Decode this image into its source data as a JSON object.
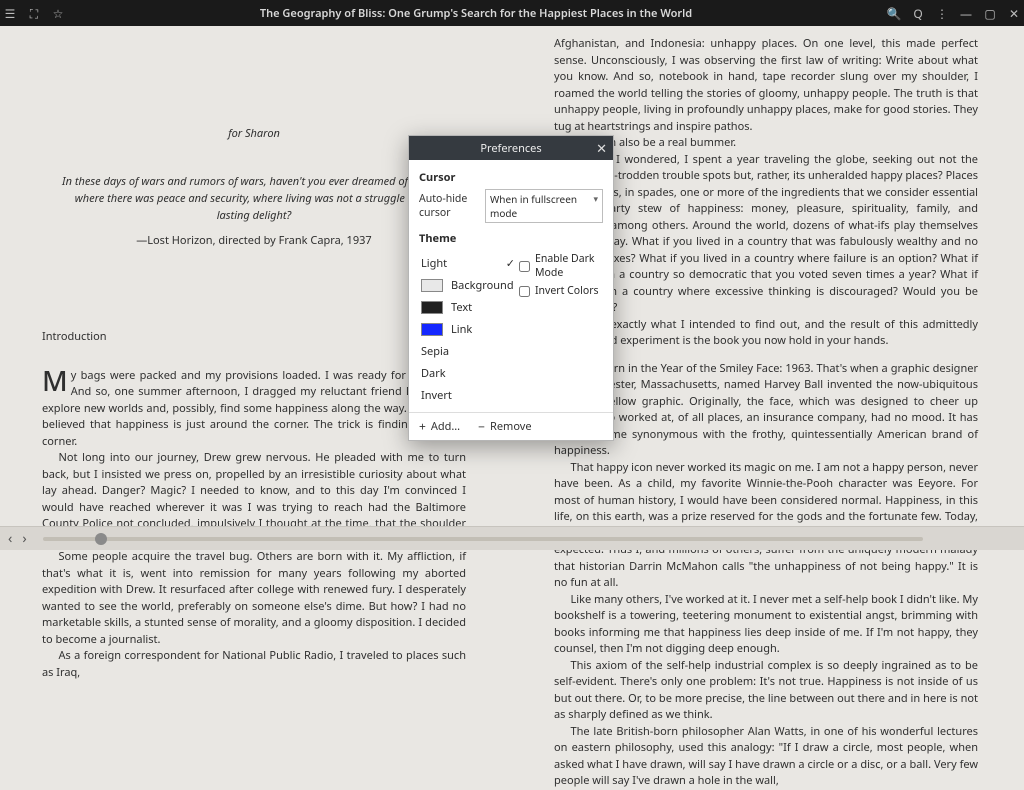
{
  "titlebar": {
    "title": "The Geography of Bliss: One Grump's Search for the Happiest Places in the World",
    "icons": {
      "toc": "☰",
      "fullscreen": "⛶",
      "star": "☆",
      "search": "🔍",
      "zoom": "Q",
      "menu": "⋮",
      "minimize": "—",
      "maximize": "▢",
      "close": "✕"
    }
  },
  "left_page": {
    "dedication": "for Sharon",
    "epigraph": "In these days of wars and rumors of wars, haven't you ever dreamed of a place where there was peace and security, where living was not a struggle but a lasting delight?",
    "epigraph_source": "—Lost Horizon, directed by Frank Capra, 1937",
    "chapter_label": "Introduction",
    "dropcap": "M",
    "p1_rest": "y bags were packed and my provisions loaded. I was ready for adventure. And so, one summer afternoon, I dragged my reluctant friend Drew off to explore new worlds and, possibly, find some happiness along the way. I've always believed that happiness is just around the corner. The trick is finding the right corner.",
    "p2": "Not long into our journey, Drew grew nervous. He pleaded with me to turn back, but I insisted we press on, propelled by an irresistible curiosity about what lay ahead. Danger? Magic? I needed to know, and to this day I'm convinced I would have reached wherever it was I was trying to reach had the Baltimore County Police not concluded, impulsively I thought at the time, that the shoulder of a major thoroughfare was no place for a couple of five-year-olds.",
    "p3": "Some people acquire the travel bug. Others are born with it. My affliction, if that's what it is, went into remission for many years following my aborted expedition with Drew. It resurfaced after college with renewed fury. I desperately wanted to see the world, preferably on someone else's dime. But how? I had no marketable skills, a stunted sense of morality, and a gloomy disposition. I decided to become a journalist.",
    "p4": "As a foreign correspondent for National Public Radio, I traveled to places such as Iraq,"
  },
  "right_page": {
    "p1": "Afghanistan, and Indonesia: unhappy places. On one level, this made perfect sense. Unconsciously, I was observing the first law of writing: Write about what you know. And so, notebook in hand, tape recorder slung over my shoulder, I roamed the world telling the stories of gloomy, unhappy people. The truth is that unhappy people, living in profoundly unhappy places, make for good stories. They tug at heartstrings and inspire pathos.",
    "p2": "They can also be a real bummer.",
    "p3": "What if, I wondered, I spent a year traveling the globe, seeking out not the world's well-trodden trouble spots but, rather, its unheralded happy places? Places that possess, in spades, one or more of the ingredients that we consider essential to the hearty stew of happiness: money, pleasure, spirituality, family, and chocolate, among others. Around the world, dozens of what-ifs play themselves out every day. What if you lived in a country that was fabulously wealthy and no one paid taxes? What if you lived in a country where failure is an option? What if you lived in a country so democratic that you voted seven times a year? What if you lived in a country where excessive thinking is discouraged? Would you be happy then?",
    "p4": "That is exactly what I intended to find out, and the result of this admittedly harebrained experiment is the book you now hold in your hands.",
    "p5": "I was born in the Year of the Smiley Face: 1963. That's when a graphic designer from Worcester, Massachusetts, named Harvey Ball invented the now-ubiquitous grinning yellow graphic. Originally, the face, which was designed to cheer up people who worked at, of all places, an insurance company, had no mood. It has since become synonymous with the frothy, quintessentially American brand of happiness.",
    "p6": "That happy icon never worked its magic on me. I am not a happy person, never have been. As a child, my favorite Winnie-the-Pooh character was Eeyore. For most of human history, I would have been considered normal. Happiness, in this life, on this earth, was a prize reserved for the gods and the fortunate few. Today, though, not only is happiness considered possible for anyone to attain, it is expected. Thus I, and millions of others, suffer from the uniquely modern malady that historian Darrin McMahon calls \"the unhappiness of not being happy.\" It is no fun at all.",
    "p7": "Like many others, I've worked at it. I never met a self-help book I didn't like. My bookshelf is a towering, teetering monument to existential angst, brimming with books informing me that happiness lies deep inside of me. If I'm not happy, they counsel, then I'm not digging deep enough.",
    "p8": "This axiom of the self-help industrial complex is so deeply ingrained as to be self-evident. There's only one problem: It's not true. Happiness is not inside of us but out there. Or, to be more precise, the line between out there and in here is not as sharply defined as we think.",
    "p9": "The late British-born philosopher Alan Watts, in one of his wonderful lectures on eastern philosophy, used this analogy: \"If I draw a circle, most people, when asked what I have drawn, will say I have drawn a circle or a disc, or a ball. Very few people will say I've drawn a hole in the wall,"
  },
  "dialog": {
    "title": "Preferences",
    "sections": {
      "cursor": "Cursor",
      "theme": "Theme"
    },
    "autohide_label": "Auto-hide cursor",
    "autohide_value": "When in fullscreen mode",
    "themes": {
      "light": "Light",
      "background": "Background",
      "text": "Text",
      "link": "Link",
      "sepia": "Sepia",
      "dark": "Dark",
      "invert": "Invert"
    },
    "checks": {
      "dark_mode": "Enable Dark Mode",
      "invert_colors": "Invert Colors"
    },
    "footer": {
      "add": "Add…",
      "remove": "Remove"
    }
  }
}
